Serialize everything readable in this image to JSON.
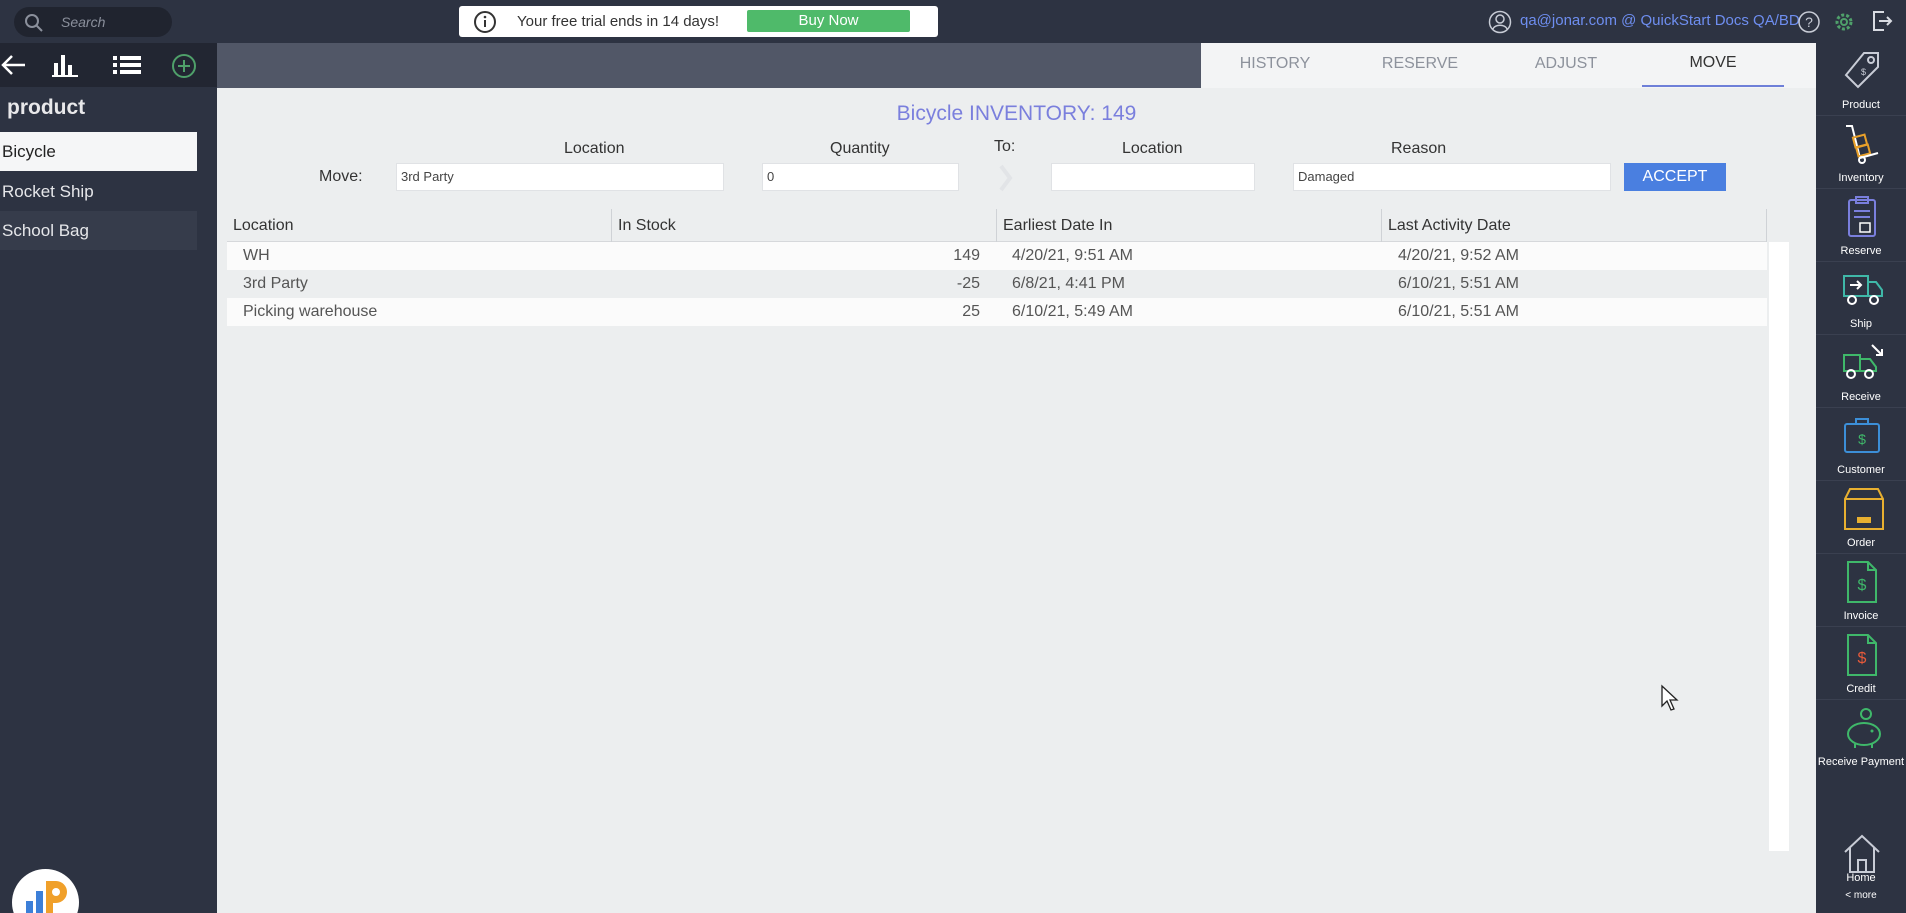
{
  "topbar": {
    "search_placeholder": "Search",
    "trial_message": "Your free trial ends in 14 days!",
    "buy_label": "Buy Now",
    "user_text": "qa@jonar.com @ QuickStart Docs QA/BD"
  },
  "sidebar": {
    "title": "product",
    "items": [
      {
        "label": "Bicycle"
      },
      {
        "label": "Rocket Ship"
      },
      {
        "label": "School Bag"
      }
    ]
  },
  "tabs": [
    {
      "label": "HISTORY"
    },
    {
      "label": "RESERVE"
    },
    {
      "label": "ADJUST"
    },
    {
      "label": "MOVE"
    }
  ],
  "main": {
    "title": "Bicycle INVENTORY: 149",
    "move_label": "Move:",
    "to_label": "To:",
    "location_label": "Location",
    "quantity_label": "Quantity",
    "to_location_label": "Location",
    "reason_label": "Reason",
    "location_value": "3rd Party",
    "quantity_value": "0",
    "to_location_value": "",
    "reason_value": "Damaged",
    "accept_label": "ACCEPT"
  },
  "table": {
    "headers": [
      "Location",
      "In Stock",
      "Earliest Date In",
      "Last Activity Date"
    ],
    "rows": [
      {
        "location": "WH",
        "stock": "149",
        "earliest": "4/20/21, 9:51 AM",
        "last": "4/20/21, 9:52 AM"
      },
      {
        "location": "3rd Party",
        "stock": "-25",
        "earliest": "6/8/21, 4:41 PM",
        "last": "6/10/21, 5:51 AM"
      },
      {
        "location": "Picking warehouse",
        "stock": "25",
        "earliest": "6/10/21, 5:49 AM",
        "last": "6/10/21, 5:51 AM"
      }
    ]
  },
  "rightbar": {
    "items": [
      {
        "label": "Product",
        "icon": "tag-icon"
      },
      {
        "label": "Inventory",
        "icon": "hand-truck-icon"
      },
      {
        "label": "Reserve",
        "icon": "clipboard-icon"
      },
      {
        "label": "Ship",
        "icon": "truck-ship-icon"
      },
      {
        "label": "Receive",
        "icon": "truck-receive-icon"
      },
      {
        "label": "Customer",
        "icon": "briefcase-icon"
      },
      {
        "label": "Order",
        "icon": "box-icon"
      },
      {
        "label": "Invoice",
        "icon": "invoice-icon"
      },
      {
        "label": "Credit",
        "icon": "credit-icon"
      },
      {
        "label": "Receive Payment",
        "icon": "piggy-bank-icon"
      }
    ],
    "home_label": "Home",
    "more_label": "< more"
  },
  "colors": {
    "accent": "#7a7fdd",
    "buy_button": "#4fba6a",
    "accept_button": "#4a7fe0",
    "user_link": "#6e8ef0"
  }
}
